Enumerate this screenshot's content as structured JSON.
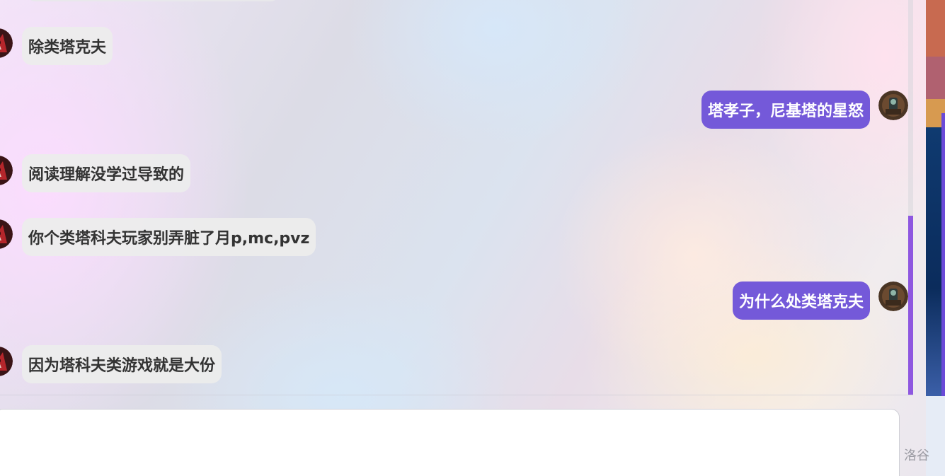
{
  "messages": [
    {
      "side": "left",
      "text": "除类塔克夫"
    },
    {
      "side": "right",
      "text": "塔孝子，尼基塔的星怒"
    },
    {
      "side": "left",
      "text": "阅读理解没学过导致的"
    },
    {
      "side": "left",
      "text": "你个类塔科夫玩家别弄脏了月p,mc,pvz"
    },
    {
      "side": "right",
      "text": "为什么处类塔克夫"
    },
    {
      "side": "left",
      "text": "因为塔科夫类游戏就是大份"
    }
  ],
  "input": {
    "value": ""
  },
  "brand": {
    "label": "洛谷"
  },
  "colors": {
    "sent_bubble": "#7459d9",
    "received_bubble": "#ececec",
    "scrollbar_thumb": "#8e57e0"
  },
  "icons": {
    "left_avatar": "game-character-avatar",
    "right_avatar": "user-photo-avatar"
  }
}
